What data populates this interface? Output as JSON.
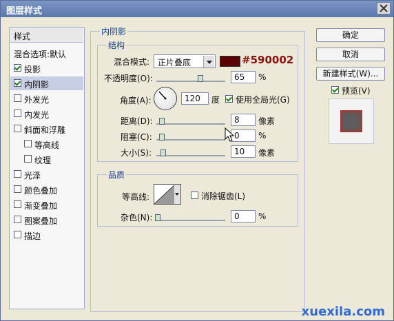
{
  "window": {
    "title": "图层样式"
  },
  "left_panel": {
    "header": "样式",
    "items": [
      {
        "label": "混合选项:默认",
        "checkbox": false,
        "checked": false,
        "selected": false
      },
      {
        "label": "投影",
        "checkbox": true,
        "checked": true,
        "selected": false
      },
      {
        "label": "内阴影",
        "checkbox": true,
        "checked": true,
        "selected": true
      },
      {
        "label": "外发光",
        "checkbox": true,
        "checked": false,
        "selected": false
      },
      {
        "label": "内发光",
        "checkbox": true,
        "checked": false,
        "selected": false
      },
      {
        "label": "斜面和浮雕",
        "checkbox": true,
        "checked": false,
        "selected": false
      },
      {
        "label": "等高线",
        "checkbox": true,
        "checked": false,
        "selected": false
      },
      {
        "label": "纹理",
        "checkbox": true,
        "checked": false,
        "selected": false
      },
      {
        "label": "光泽",
        "checkbox": true,
        "checked": false,
        "selected": false
      },
      {
        "label": "颜色叠加",
        "checkbox": true,
        "checked": false,
        "selected": false
      },
      {
        "label": "渐变叠加",
        "checkbox": true,
        "checked": false,
        "selected": false
      },
      {
        "label": "图案叠加",
        "checkbox": true,
        "checked": false,
        "selected": false
      },
      {
        "label": "描边",
        "checkbox": true,
        "checked": false,
        "selected": false
      }
    ]
  },
  "inner_shadow": {
    "title": "内阴影",
    "structure": {
      "title": "结构",
      "blend_mode_label": "混合模式:",
      "blend_mode_value": "正片叠底",
      "color_hex_text": "#590002",
      "opacity_label": "不透明度(O):",
      "opacity_value": "65",
      "opacity_unit": "%",
      "angle_label": "角度(A):",
      "angle_value": "120",
      "angle_unit": "度",
      "global_light_label": "使用全局光(G)",
      "global_light_checked": true,
      "distance_label": "距离(D):",
      "distance_value": "8",
      "distance_unit": "像素",
      "choke_label": "阻塞(C):",
      "choke_value": "0",
      "choke_unit": "%",
      "size_label": "大小(S):",
      "size_value": "10",
      "size_unit": "像素"
    },
    "quality": {
      "title": "品质",
      "contour_label": "等高线:",
      "antialias_label": "消除锯齿(L)",
      "antialias_checked": false,
      "noise_label": "杂色(N):",
      "noise_value": "0",
      "noise_unit": "%"
    }
  },
  "buttons": {
    "ok": "确定",
    "cancel": "取消",
    "new_style": "新建样式(W)...",
    "preview_label": "预览(V)",
    "preview_checked": true
  },
  "colors": {
    "shadow_color": "#590002"
  },
  "watermark": "xuexila.com"
}
